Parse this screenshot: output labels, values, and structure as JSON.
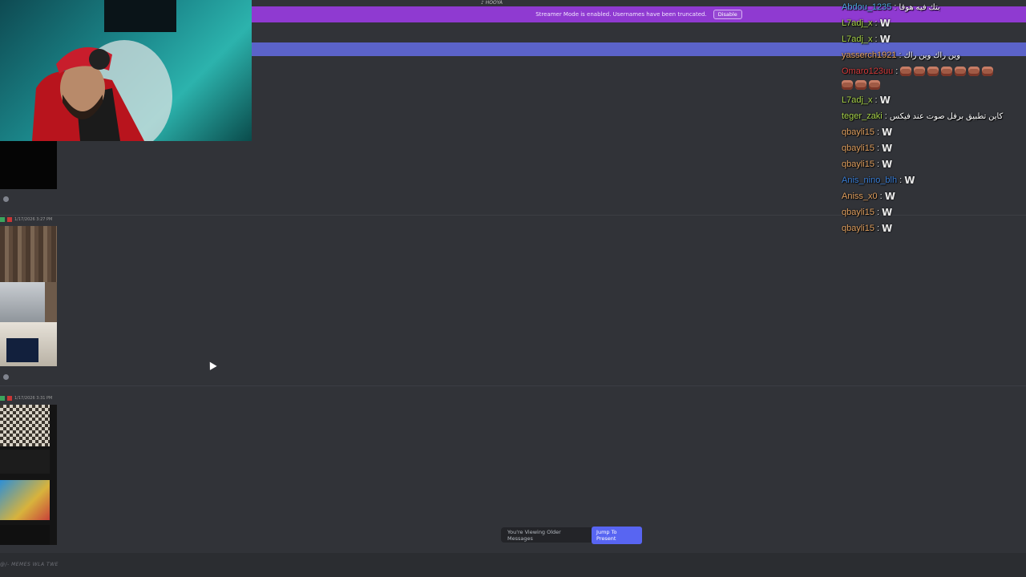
{
  "top_label": "♪ HOOYA",
  "banner": {
    "text": "Streamer Mode is enabled. Usernames have been truncated.",
    "disable_label": "Disable",
    "color": "#8f3ad1"
  },
  "messages": [
    {
      "timestamp": "1/17/2026 3:27 PM"
    },
    {
      "timestamp": "1/17/2026 3:31 PM"
    }
  ],
  "older_messages": {
    "text": "You're Viewing Older Messages",
    "jump_label": "Jump To Present"
  },
  "bottom_text": "@/- MEMES WLA TWE",
  "chat": [
    {
      "user": "Abdou_1235",
      "color": "#4fa8e0",
      "text": "بتك فيه هوقا",
      "emote": ""
    },
    {
      "user": "L7adj_x",
      "color": "#a8d44a",
      "text": "",
      "emote": "W"
    },
    {
      "user": "L7adj_x",
      "color": "#a8d44a",
      "text": "",
      "emote": "W"
    },
    {
      "user": "yasserch1921",
      "color": "#e0a060",
      "text": "وين راك وين راك",
      "emote": ""
    },
    {
      "user": "Omaro123uu",
      "color": "#d23a3a",
      "text": "",
      "emote": "faces"
    },
    {
      "user": "L7adj_x",
      "color": "#a8d44a",
      "text": "",
      "emote": "W"
    },
    {
      "user": "teger_zaki",
      "color": "#a8d44a",
      "text": "كاين تطبيق برفل صوت عند فيكس",
      "emote": ""
    },
    {
      "user": "qbayli15",
      "color": "#e0a060",
      "text": "",
      "emote": "W"
    },
    {
      "user": "qbayli15",
      "color": "#e0a060",
      "text": "",
      "emote": "W"
    },
    {
      "user": "qbayli15",
      "color": "#e0a060",
      "text": "",
      "emote": "W"
    },
    {
      "user": "Anis_nino_blh",
      "color": "#3b7fd6",
      "text": "",
      "emote": "W"
    },
    {
      "user": "Aniss_x0",
      "color": "#e0a060",
      "text": "",
      "emote": "W"
    },
    {
      "user": "qbayli15",
      "color": "#e0a060",
      "text": "",
      "emote": "W"
    },
    {
      "user": "qbayli15",
      "color": "#e0a060",
      "text": "",
      "emote": "W"
    }
  ],
  "colors": {
    "background": "#313338",
    "accent": "#5865f2",
    "blue_bar": "#5b63c9"
  }
}
